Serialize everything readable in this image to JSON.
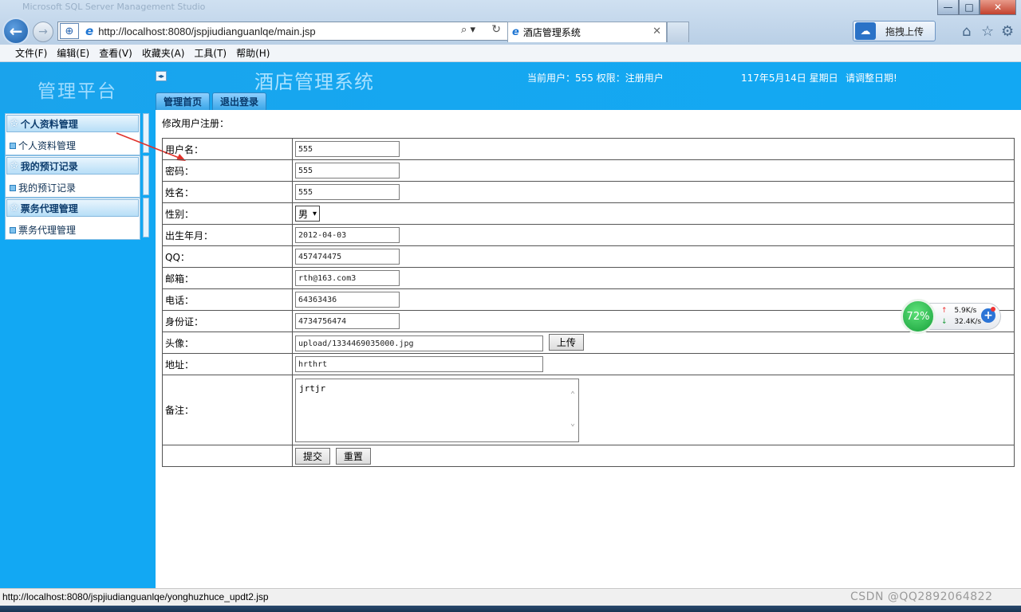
{
  "browser": {
    "window_caption": "Microsoft SQL Server Management Studio",
    "window_buttons": {
      "minimize": "—",
      "maximize": "□",
      "close": "✕"
    },
    "address": "http://localhost:8080/jspjiudianguanlqe/main.jsp",
    "tab_title": "酒店管理系统",
    "upload_tool_label": "拖拽上传"
  },
  "menu": [
    "文件(F)",
    "编辑(E)",
    "查看(V)",
    "收藏夹(A)",
    "工具(T)",
    "帮助(H)"
  ],
  "header": {
    "platform_title": "管理平台",
    "system_title": "酒店管理系统",
    "user_info": "当前用户：555 权限：注册用户",
    "date": "117年5月14日  星期日",
    "date_tip": "请调整日期!",
    "tabs": [
      "管理首页",
      "退出登录"
    ]
  },
  "sidebar": {
    "groups": [
      {
        "title": "个人资料管理",
        "link": "个人资料管理"
      },
      {
        "title": "我的预订记录",
        "link": "我的预订记录"
      },
      {
        "title": "票务代理管理",
        "link": "票务代理管理"
      }
    ]
  },
  "form": {
    "title": "修改用户注册：",
    "fields": {
      "username": {
        "label": "用户名：",
        "value": "555"
      },
      "password": {
        "label": "密码：",
        "value": "555"
      },
      "name": {
        "label": "姓名：",
        "value": "555"
      },
      "gender": {
        "label": "性别：",
        "value": "男"
      },
      "birthday": {
        "label": "出生年月：",
        "value": "2012-04-03"
      },
      "qq": {
        "label": "QQ：",
        "value": "457474475"
      },
      "email": {
        "label": "邮箱：",
        "value": "rth@163.com3"
      },
      "phone": {
        "label": "电话：",
        "value": "64363436"
      },
      "id_card": {
        "label": "身份证：",
        "value": "4734756474"
      },
      "avatar": {
        "label": "头像：",
        "value": "upload/1334469035000.jpg"
      },
      "address": {
        "label": "地址：",
        "value": "hrthrt"
      },
      "remark": {
        "label": "备注：",
        "value": "jrtjr"
      }
    },
    "upload_button": "上传",
    "submit_button": "提交",
    "reset_button": "重置"
  },
  "speed_widget": {
    "percent": "72%",
    "upload": "5.9K/s",
    "download": "32.4K/s",
    "plus": "+"
  },
  "status": {
    "url": "http://localhost:8080/jspjiudianguanlqe/yonghuzhuce_updt2.jsp",
    "watermark": "CSDN @QQ2892064822"
  },
  "colors": {
    "header_blue": "#12a8f3",
    "arrow_red": "#e0322b"
  }
}
